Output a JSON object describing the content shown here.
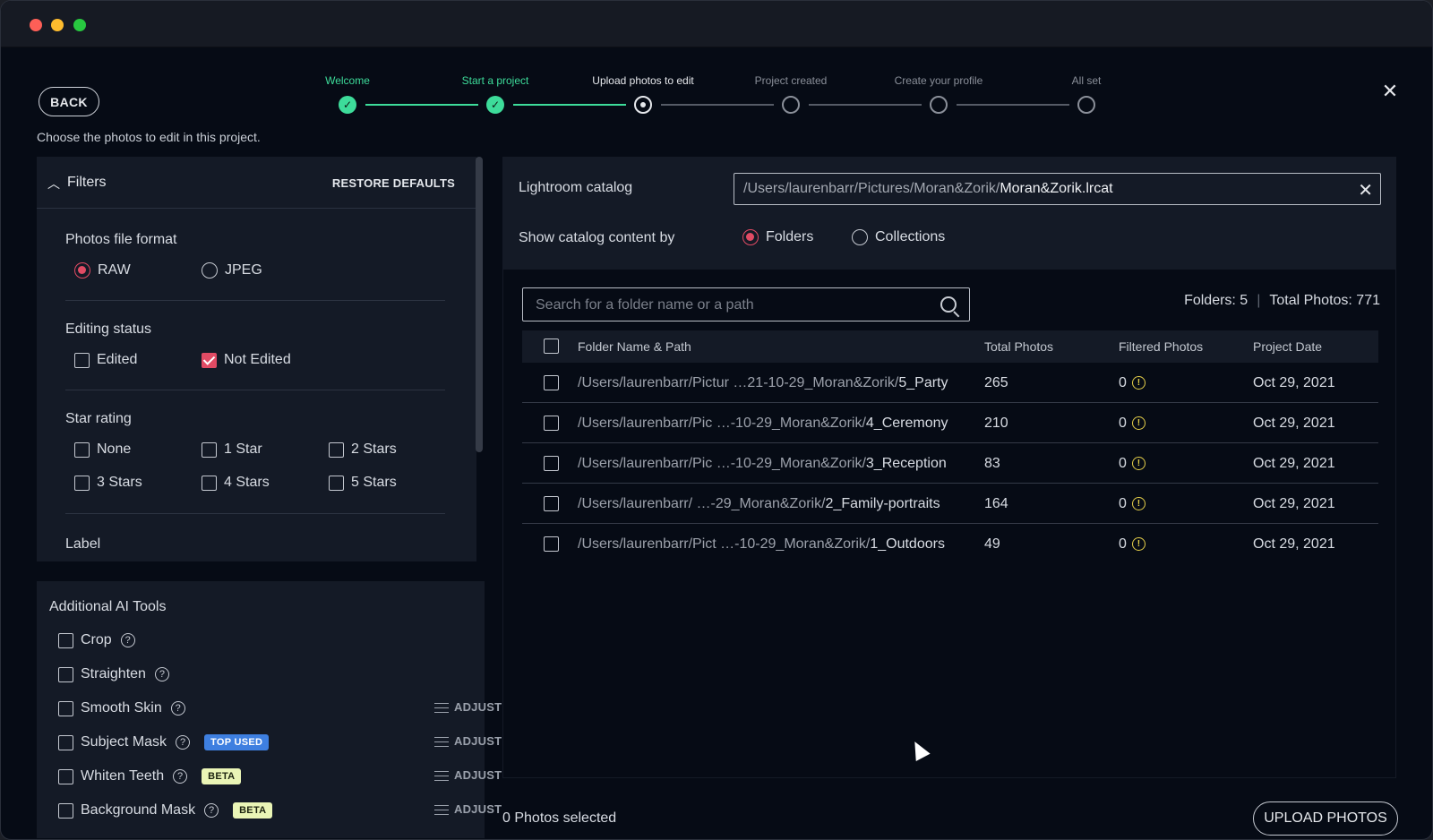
{
  "header": {
    "back_label": "BACK",
    "subtitle": "Choose the photos to edit in this project.",
    "close_label": "✕"
  },
  "stepper": {
    "steps": [
      {
        "label": "Welcome",
        "state": "done"
      },
      {
        "label": "Start a project",
        "state": "done"
      },
      {
        "label": "Upload photos to edit",
        "state": "current"
      },
      {
        "label": "Project created",
        "state": "todo"
      },
      {
        "label": "Create your profile",
        "state": "todo"
      },
      {
        "label": "All set",
        "state": "todo"
      }
    ],
    "done_color": "#3ddc9a",
    "check_glyph": "✓"
  },
  "filters": {
    "title": "Filters",
    "chevron": "︿",
    "restore_label": "RESTORE DEFAULTS",
    "file_format": {
      "title": "Photos file format",
      "options": [
        {
          "label": "RAW",
          "checked": true
        },
        {
          "label": "JPEG",
          "checked": false
        }
      ]
    },
    "editing_status": {
      "title": "Editing status",
      "options": [
        {
          "label": "Edited",
          "checked": false
        },
        {
          "label": "Not Edited",
          "checked": true
        }
      ]
    },
    "star_rating": {
      "title": "Star rating",
      "options": [
        {
          "label": "None",
          "checked": false
        },
        {
          "label": "1 Star",
          "checked": false
        },
        {
          "label": "2 Stars",
          "checked": false
        },
        {
          "label": "3 Stars",
          "checked": false
        },
        {
          "label": "4 Stars",
          "checked": false
        },
        {
          "label": "5 Stars",
          "checked": false
        }
      ]
    },
    "label_title": "Label"
  },
  "ai_tools": {
    "title": "Additional AI Tools",
    "help_glyph": "?",
    "adjust_label": "ADJUST",
    "items": [
      {
        "label": "Crop",
        "badge": "",
        "adjust": false
      },
      {
        "label": "Straighten",
        "badge": "",
        "adjust": false
      },
      {
        "label": "Smooth Skin",
        "badge": "",
        "adjust": true
      },
      {
        "label": "Subject Mask",
        "badge": "TOP USED",
        "badge_style": "blue",
        "adjust": true
      },
      {
        "label": "Whiten Teeth",
        "badge": "BETA",
        "badge_style": "yellow",
        "adjust": true
      },
      {
        "label": "Background Mask",
        "badge": "BETA",
        "badge_style": "yellow",
        "adjust": true
      }
    ]
  },
  "catalog": {
    "label": "Lightroom catalog",
    "path_dim": "/Users/laurenbarr/Pictures/Moran&Zorik/",
    "path_file": "Moran&Zorik.lrcat",
    "show_by_label": "Show catalog content by",
    "show_by_options": [
      {
        "label": "Folders",
        "checked": true
      },
      {
        "label": "Collections",
        "checked": false
      }
    ]
  },
  "folders": {
    "search_placeholder": "Search for a folder name or a path",
    "folders_count": "Folders: 5",
    "separator": "|",
    "total_photos": "Total Photos: 771",
    "columns": [
      "Folder Name & Path",
      "Total Photos",
      "Filtered Photos",
      "Project Date"
    ],
    "rows": [
      {
        "path_dim": "/Users/laurenbarr/Pictur …21-10-29_Moran&Zorik/",
        "name": "5_Party",
        "total": "265",
        "filtered": "0",
        "date": "Oct 29, 2021"
      },
      {
        "path_dim": "/Users/laurenbarr/Pic …-10-29_Moran&Zorik/",
        "name": "4_Ceremony",
        "total": "210",
        "filtered": "0",
        "date": "Oct 29, 2021"
      },
      {
        "path_dim": "/Users/laurenbarr/Pic …-10-29_Moran&Zorik/",
        "name": "3_Reception",
        "total": "83",
        "filtered": "0",
        "date": "Oct 29, 2021"
      },
      {
        "path_dim": "/Users/laurenbarr/ …-29_Moran&Zorik/",
        "name": "2_Family-portraits",
        "total": "164",
        "filtered": "0",
        "date": "Oct 29, 2021"
      },
      {
        "path_dim": "/Users/laurenbarr/Pict …-10-29_Moran&Zorik/",
        "name": "1_Outdoors",
        "total": "49",
        "filtered": "0",
        "date": "Oct 29, 2021"
      }
    ],
    "warn_glyph": "!"
  },
  "footer": {
    "selected_label": "0 Photos selected",
    "upload_label": "UPLOAD PHOTOS"
  },
  "colors": {
    "accent": "#e14b64",
    "success": "#3ddc9a",
    "badge_blue": "#3e7fe0",
    "badge_yellow": "#eaf5b6"
  }
}
